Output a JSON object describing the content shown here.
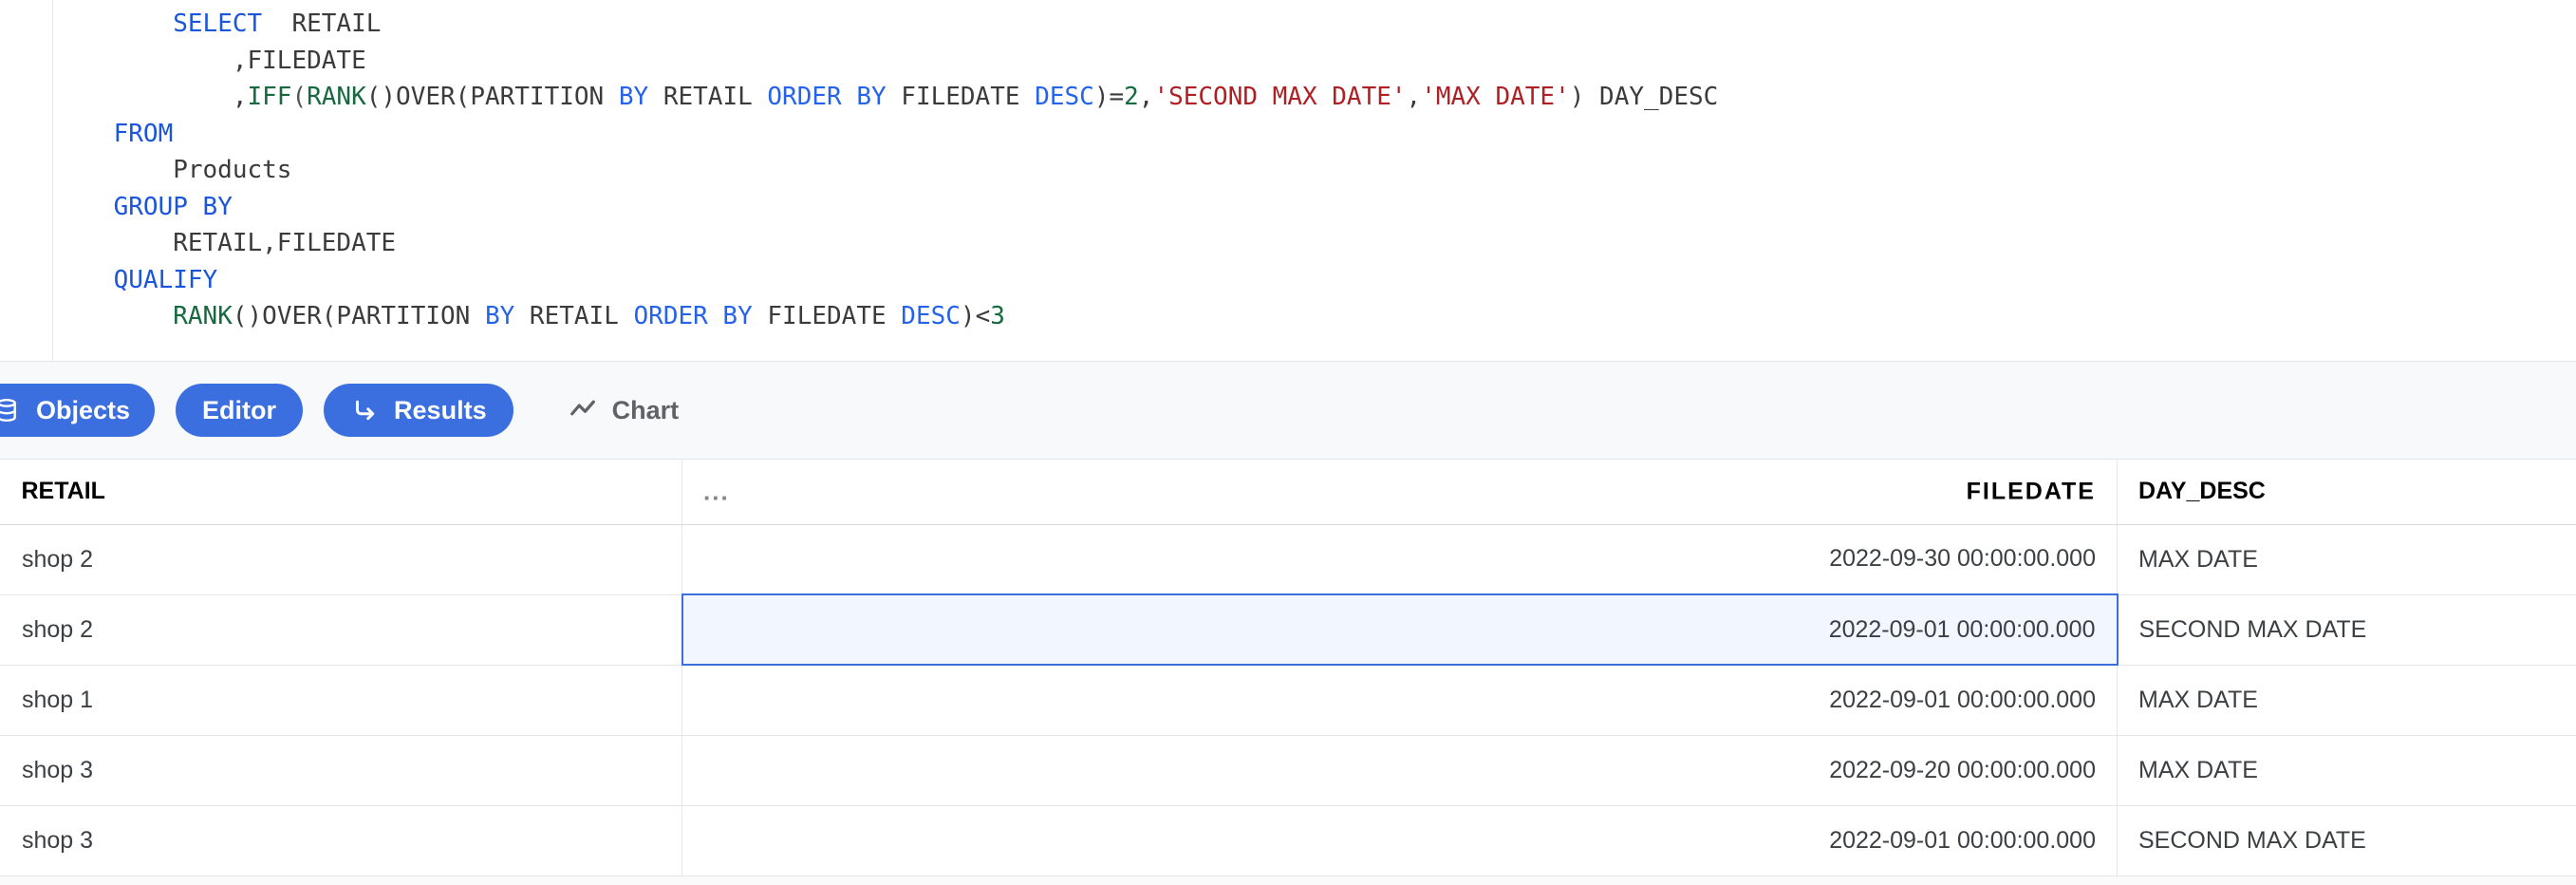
{
  "editor": {
    "language": "sql",
    "lines": [
      [
        {
          "t": "        ",
          "c": "plain"
        },
        {
          "t": "SELECT",
          "c": "kw"
        },
        {
          "t": "  RETAIL",
          "c": "plain"
        }
      ],
      [
        {
          "t": "            ,FILEDATE",
          "c": "plain"
        }
      ],
      [
        {
          "t": "            ,",
          "c": "plain"
        },
        {
          "t": "IFF",
          "c": "fn"
        },
        {
          "t": "(",
          "c": "punc"
        },
        {
          "t": "RANK",
          "c": "fn"
        },
        {
          "t": "()OVER(PARTITION ",
          "c": "plain"
        },
        {
          "t": "BY",
          "c": "kw2"
        },
        {
          "t": " RETAIL ",
          "c": "plain"
        },
        {
          "t": "ORDER BY",
          "c": "kw2"
        },
        {
          "t": " FILEDATE ",
          "c": "plain"
        },
        {
          "t": "DESC",
          "c": "kw2"
        },
        {
          "t": ")=",
          "c": "plain"
        },
        {
          "t": "2",
          "c": "num"
        },
        {
          "t": ",",
          "c": "plain"
        },
        {
          "t": "'SECOND MAX DATE'",
          "c": "str"
        },
        {
          "t": ",",
          "c": "plain"
        },
        {
          "t": "'MAX DATE'",
          "c": "str"
        },
        {
          "t": ") DAY_DESC",
          "c": "plain"
        }
      ],
      [
        {
          "t": "    ",
          "c": "plain"
        },
        {
          "t": "FROM",
          "c": "kw"
        }
      ],
      [
        {
          "t": "        Products",
          "c": "plain"
        }
      ],
      [
        {
          "t": "    ",
          "c": "plain"
        },
        {
          "t": "GROUP BY",
          "c": "kw"
        }
      ],
      [
        {
          "t": "        RETAIL,FILEDATE",
          "c": "plain"
        }
      ],
      [
        {
          "t": "    ",
          "c": "plain"
        },
        {
          "t": "QUALIFY",
          "c": "kw"
        }
      ],
      [
        {
          "t": "        ",
          "c": "plain"
        },
        {
          "t": "RANK",
          "c": "fn"
        },
        {
          "t": "()OVER(PARTITION ",
          "c": "plain"
        },
        {
          "t": "BY",
          "c": "kw2"
        },
        {
          "t": " RETAIL ",
          "c": "plain"
        },
        {
          "t": "ORDER BY",
          "c": "kw2"
        },
        {
          "t": " FILEDATE ",
          "c": "plain"
        },
        {
          "t": "DESC",
          "c": "kw2"
        },
        {
          "t": ")<",
          "c": "plain"
        },
        {
          "t": "3",
          "c": "num"
        }
      ]
    ]
  },
  "tabs": [
    {
      "id": "objects",
      "label": "Objects",
      "icon": "database-icon",
      "active": true
    },
    {
      "id": "editor",
      "label": "Editor",
      "icon": "none",
      "active": true
    },
    {
      "id": "results",
      "label": "Results",
      "icon": "corner-down-right-icon",
      "active": true
    },
    {
      "id": "chart",
      "label": "Chart",
      "icon": "trend-line-icon",
      "active": false
    }
  ],
  "results_grid": {
    "columns": [
      {
        "key": "retail",
        "label": "RETAIL",
        "align": "left"
      },
      {
        "key": "filedate",
        "label": "FILEDATE",
        "align": "right",
        "menu": "..."
      },
      {
        "key": "day_desc",
        "label": "DAY_DESC",
        "align": "left"
      }
    ],
    "rows": [
      {
        "retail": "shop 2",
        "filedate": "2022-09-30 00:00:00.000",
        "day_desc": "MAX DATE",
        "selected_cell": null
      },
      {
        "retail": "shop 2",
        "filedate": "2022-09-01 00:00:00.000",
        "day_desc": "SECOND MAX DATE",
        "selected_cell": "filedate"
      },
      {
        "retail": "shop 1",
        "filedate": "2022-09-01 00:00:00.000",
        "day_desc": "MAX DATE",
        "selected_cell": null
      },
      {
        "retail": "shop 3",
        "filedate": "2022-09-20 00:00:00.000",
        "day_desc": "MAX DATE",
        "selected_cell": null
      },
      {
        "retail": "shop 3",
        "filedate": "2022-09-01 00:00:00.000",
        "day_desc": "SECOND MAX DATE",
        "selected_cell": null
      }
    ]
  },
  "colors": {
    "accent": "#3b6fe0",
    "selection_fill": "#f2f6fe",
    "keyword": "#1a56db",
    "function": "#17693f",
    "string": "#b01f24",
    "number": "#17693f",
    "text": "#3b3b3b",
    "tabbar_bg": "#f8f9fa",
    "grid_border": "#e4e6ea"
  }
}
